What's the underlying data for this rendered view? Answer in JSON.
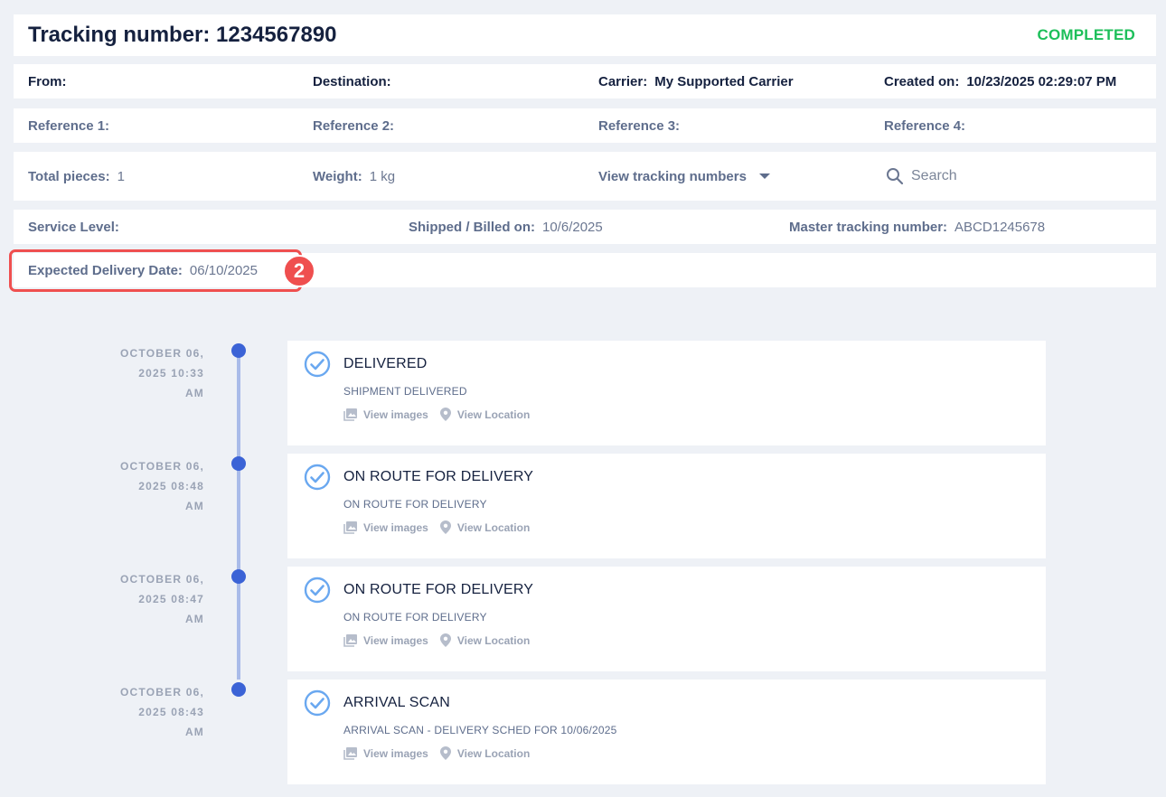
{
  "header": {
    "title": "Tracking number: 1234567890",
    "status": "COMPLETED"
  },
  "row1": {
    "from_label": "From:",
    "destination_label": "Destination:",
    "carrier_label": "Carrier:",
    "carrier_value": "My Supported Carrier",
    "created_label": "Created on:",
    "created_value": "10/23/2025 02:29:07 PM"
  },
  "row2": {
    "ref1_label": "Reference 1:",
    "ref2_label": "Reference 2:",
    "ref3_label": "Reference 3:",
    "ref4_label": "Reference 4:"
  },
  "row3": {
    "pieces_label": "Total pieces:",
    "pieces_value": "1",
    "weight_label": "Weight:",
    "weight_value": "1 kg",
    "tracking_dropdown_label": "View tracking numbers",
    "search_placeholder": "Search"
  },
  "row4": {
    "service_label": "Service Level:",
    "shipped_label": "Shipped / Billed on:",
    "shipped_value": "10/6/2025",
    "master_label": "Master tracking number:",
    "master_value": "ABCD1245678"
  },
  "row5": {
    "expected_label": "Expected Delivery Date:",
    "expected_value": "06/10/2025"
  },
  "annotation": {
    "badge_number": "2",
    "color": "#ef4f4f"
  },
  "events": [
    {
      "date_line1": "OCTOBER 06,",
      "date_line2": "2025 10:33",
      "date_line3": "AM",
      "title": "DELIVERED",
      "subtitle": "SHIPMENT DELIVERED",
      "images_label": "View images",
      "location_label": "View Location"
    },
    {
      "date_line1": "OCTOBER 06,",
      "date_line2": "2025 08:48",
      "date_line3": "AM",
      "title": "ON ROUTE FOR DELIVERY",
      "subtitle": "ON ROUTE FOR DELIVERY",
      "images_label": "View images",
      "location_label": "View Location"
    },
    {
      "date_line1": "OCTOBER 06,",
      "date_line2": "2025 08:47",
      "date_line3": "AM",
      "title": "ON ROUTE FOR DELIVERY",
      "subtitle": "ON ROUTE FOR DELIVERY",
      "images_label": "View images",
      "location_label": "View Location"
    },
    {
      "date_line1": "OCTOBER 06,",
      "date_line2": "2025 08:43",
      "date_line3": "AM",
      "title": "ARRIVAL SCAN",
      "subtitle": "ARRIVAL SCAN - DELIVERY SCHED FOR 10/06/2025",
      "images_label": "View images",
      "location_label": "View Location"
    }
  ],
  "colors": {
    "background": "#eef1f6",
    "status_green": "#1dbf5a",
    "timeline_dot": "#3b63d6",
    "timeline_line": "#a9bbe9",
    "check_icon": "#6aa8f0"
  }
}
